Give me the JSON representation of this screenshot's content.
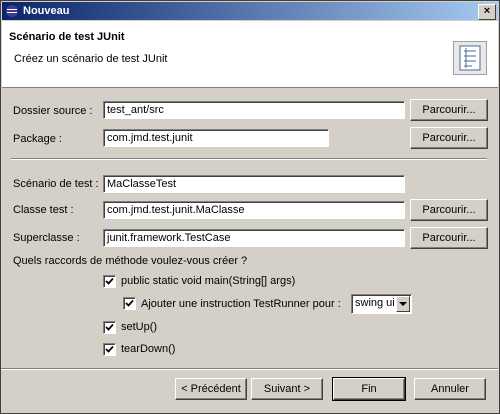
{
  "window": {
    "title": "Nouveau",
    "close_glyph": "×"
  },
  "header": {
    "title": "Scénario de test JUnit",
    "description": "Créez un scénario de test JUnit"
  },
  "form": {
    "source_folder": {
      "label": "Dossier source :",
      "value": "test_ant/src",
      "button": "Parcourir..."
    },
    "package": {
      "label": "Package :",
      "value": "com.jmd.test.junit",
      "button": "Parcourir..."
    },
    "test_case": {
      "label": "Scénario de test :",
      "value": "MaClasseTest"
    },
    "class_under_test": {
      "label": "Classe test :",
      "value": "com.jmd.test.junit.MaClasse",
      "button": "Parcourir..."
    },
    "superclass": {
      "label": "Superclasse :",
      "value": "junit.framework.TestCase",
      "button": "Parcourir..."
    }
  },
  "stubs": {
    "question": "Quels raccords de méthode voulez-vous créer ?",
    "main": {
      "label": "public static void main(String[] args)",
      "checked": true
    },
    "testrunner": {
      "label": "Ajouter une instruction TestRunner pour :",
      "checked": true,
      "selected": "swing ui"
    },
    "setup": {
      "label": "setUp()",
      "checked": true
    },
    "teardown": {
      "label": "tearDown()",
      "checked": true
    }
  },
  "buttons": {
    "back": "< Précédent",
    "next": "Suivant >",
    "finish": "Fin",
    "cancel": "Annuler"
  },
  "colors": {
    "titlebar_start": "#0a246a",
    "titlebar_end": "#a6caf0",
    "dialog_bg": "#d4d0c8"
  },
  "icons": {
    "app": "eclipse-icon",
    "banner": "junit-wizard-icon"
  }
}
